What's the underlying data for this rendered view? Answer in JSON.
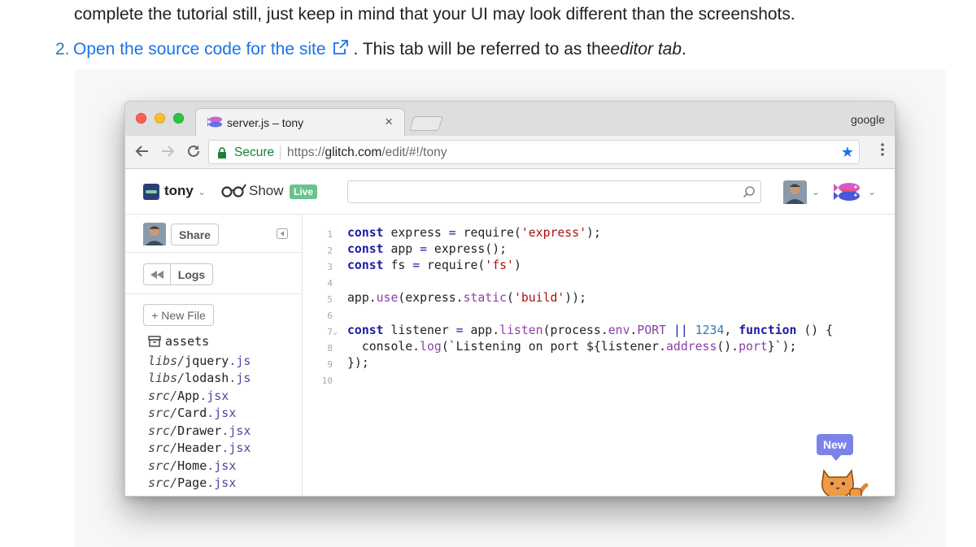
{
  "doc": {
    "line1": "complete the tutorial still, just keep in mind that your UI may look different than the screenshots.",
    "step_number": "2.",
    "link_text": "Open the source code for the site",
    "after_link": ". This tab will be referred to as the ",
    "italic_text": "editor tab",
    "end_period": "."
  },
  "browser": {
    "tab_title": "server.js – tony",
    "tab_close": "×",
    "profile": "google",
    "secure_label": "Secure",
    "url_scheme": "https://",
    "url_host": "glitch.com",
    "url_path": "/edit/#!/tony"
  },
  "glitch": {
    "project_name": "tony",
    "show_label": "Show",
    "live_badge": "Live",
    "share_label": "Share",
    "logs_label": "Logs",
    "new_file_label": "+ New File",
    "new_badge": "New",
    "files": [
      {
        "dir": "",
        "name": "assets",
        "ext": ""
      },
      {
        "dir": "libs/",
        "name": "jquery",
        "ext": ".js"
      },
      {
        "dir": "libs/",
        "name": "lodash",
        "ext": ".js"
      },
      {
        "dir": "src/",
        "name": "App",
        "ext": ".jsx"
      },
      {
        "dir": "src/",
        "name": "Card",
        "ext": ".jsx"
      },
      {
        "dir": "src/",
        "name": "Drawer",
        "ext": ".jsx"
      },
      {
        "dir": "src/",
        "name": "Header",
        "ext": ".jsx"
      },
      {
        "dir": "src/",
        "name": "Home",
        "ext": ".jsx"
      },
      {
        "dir": "src/",
        "name": "Page",
        "ext": ".jsx"
      }
    ]
  },
  "code": {
    "line_numbers": [
      "1",
      "2",
      "3",
      "4",
      "5",
      "6",
      "7",
      "8",
      "9",
      "10"
    ],
    "lines": [
      "const express = require('express');",
      "const app = express();",
      "const fs = require('fs')",
      "",
      "app.use(express.static('build'));",
      "",
      "const listener = app.listen(process.env.PORT || 1234, function () {",
      "  console.log(`Listening on port ${listener.address().port}`);",
      "});",
      ""
    ]
  },
  "colors": {
    "link": "#1a73e8",
    "secure_green": "#188038",
    "live_green": "#69c38c",
    "new_purple": "#7b83e8"
  },
  "icons": [
    "external-link-icon",
    "lock-icon",
    "star-icon",
    "menu-icon",
    "back-icon",
    "forward-icon",
    "reload-icon",
    "glasses-icon",
    "search-icon",
    "collapse-icon",
    "rewind-icon",
    "folder-icon",
    "cat-icon",
    "fish-logo-icon"
  ]
}
